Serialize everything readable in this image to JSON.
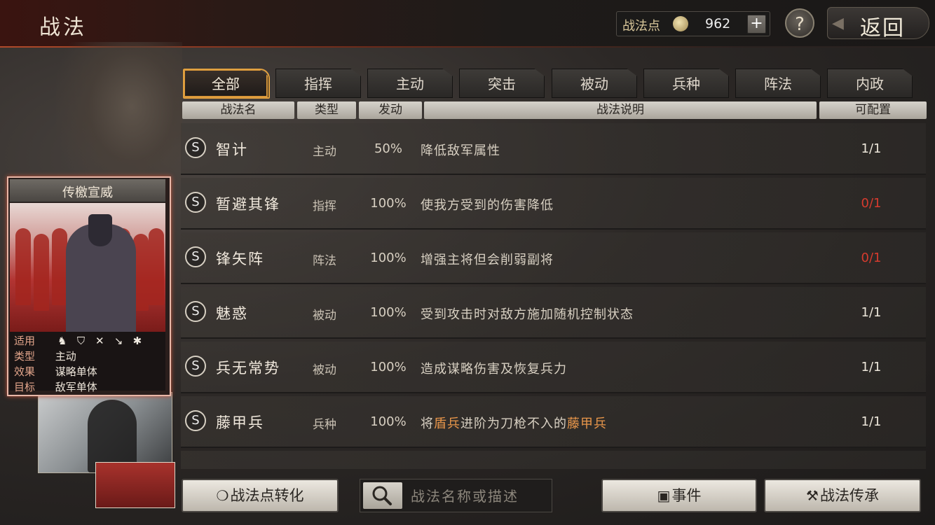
{
  "header": {
    "title": "战法",
    "points_label": "战法点",
    "points_value": "962",
    "plus_label": "+",
    "help_label": "?",
    "back_label": "返回"
  },
  "card": {
    "title": "传檄宣威",
    "rows": [
      {
        "key": "适用",
        "val": ""
      },
      {
        "key": "类型",
        "val": "主动"
      },
      {
        "key": "效果",
        "val": "谋略单体"
      },
      {
        "key": "目标",
        "val": "敌军单体"
      }
    ],
    "troop_icons": [
      "cavalry-icon",
      "shield-icon",
      "bow-icon",
      "spear-icon",
      "wheel-icon"
    ]
  },
  "tabs": [
    {
      "label": "全部",
      "active": true
    },
    {
      "label": "指挥",
      "active": false
    },
    {
      "label": "主动",
      "active": false
    },
    {
      "label": "突击",
      "active": false
    },
    {
      "label": "被动",
      "active": false
    },
    {
      "label": "兵种",
      "active": false
    },
    {
      "label": "阵法",
      "active": false
    },
    {
      "label": "内政",
      "active": false
    }
  ],
  "columns": [
    "战法名",
    "类型",
    "发动",
    "战法说明",
    "可配置"
  ],
  "rows": [
    {
      "grade": "S",
      "name": "智计",
      "type": "主动",
      "rate": "50%",
      "desc": [
        "降低敌军属性"
      ],
      "cfg": "1/1",
      "cfg_color": "normal"
    },
    {
      "grade": "S",
      "name": "暂避其锋",
      "type": "指挥",
      "rate": "100%",
      "desc": [
        "使我方受到的伤害降低"
      ],
      "cfg": "0/1",
      "cfg_color": "#d63b2e"
    },
    {
      "grade": "S",
      "name": "锋矢阵",
      "type": "阵法",
      "rate": "100%",
      "desc": [
        "增强主将但会削弱副将"
      ],
      "cfg": "0/1",
      "cfg_color": "#d63b2e"
    },
    {
      "grade": "S",
      "name": "魅惑",
      "type": "被动",
      "rate": "100%",
      "desc": [
        "受到攻击时对敌方施加随机控制状态"
      ],
      "cfg": "1/1",
      "cfg_color": "normal"
    },
    {
      "grade": "S",
      "name": "兵无常势",
      "type": "被动",
      "rate": "100%",
      "desc": [
        "造成谋略伤害及恢复兵力"
      ],
      "cfg": "1/1",
      "cfg_color": "normal"
    },
    {
      "grade": "S",
      "name": "藤甲兵",
      "type": "兵种",
      "rate": "100%",
      "desc": [
        "将",
        "盾兵",
        "进阶为刀枪不入的",
        "藤甲兵"
      ],
      "cfg": "1/1",
      "cfg_color": "normal"
    }
  ],
  "footer": {
    "convert_label": "战法点转化",
    "search_placeholder": "战法名称或描述",
    "event_label": "事件",
    "inherit_label": "战法传承"
  },
  "colors": {
    "accent_orange": "#e0a040",
    "highlight_text": "#e8964a",
    "warning_red": "#d63b2e"
  }
}
